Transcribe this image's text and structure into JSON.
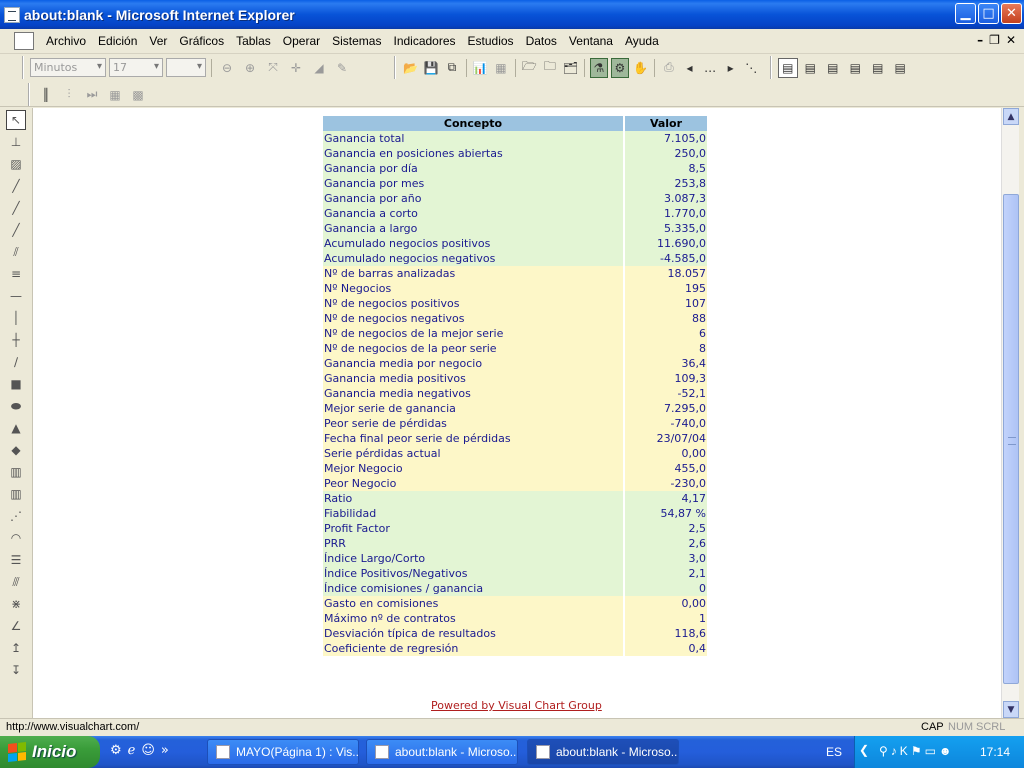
{
  "window": {
    "title": "about:blank - Microsoft Internet Explorer"
  },
  "menu": [
    "Archivo",
    "Edición",
    "Ver",
    "Gráficos",
    "Tablas",
    "Operar",
    "Sistemas",
    "Indicadores",
    "Estudios",
    "Datos",
    "Ventana",
    "Ayuda"
  ],
  "toolbar": {
    "timeframe": "Minutos",
    "period": "17",
    "third": ""
  },
  "table": {
    "headers": [
      "Concepto",
      "Valor"
    ],
    "rows": [
      {
        "c": "Ganancia total",
        "v": "7.105,0",
        "color": "green"
      },
      {
        "c": "Ganancia en posiciones abiertas",
        "v": "250,0",
        "color": "green"
      },
      {
        "c": "Ganancia por día",
        "v": "8,5",
        "color": "green"
      },
      {
        "c": "Ganancia por mes",
        "v": "253,8",
        "color": "green"
      },
      {
        "c": "Ganancia por año",
        "v": "3.087,3",
        "color": "green"
      },
      {
        "c": "Ganancia a corto",
        "v": "1.770,0",
        "color": "green"
      },
      {
        "c": "Ganancia a largo",
        "v": "5.335,0",
        "color": "green"
      },
      {
        "c": "Acumulado negocios positivos",
        "v": "11.690,0",
        "color": "green"
      },
      {
        "c": "Acumulado negocios negativos",
        "v": "-4.585,0",
        "color": "green"
      },
      {
        "c": "Nº de barras analizadas",
        "v": "18.057",
        "color": "yellow"
      },
      {
        "c": "Nº Negocios",
        "v": "195",
        "color": "yellow"
      },
      {
        "c": "Nº de negocios positivos",
        "v": "107",
        "color": "yellow"
      },
      {
        "c": "Nº de negocios negativos",
        "v": "88",
        "color": "yellow"
      },
      {
        "c": "Nº de negocios de la mejor serie",
        "v": "6",
        "color": "yellow"
      },
      {
        "c": "Nº de negocios de la peor serie",
        "v": "8",
        "color": "yellow"
      },
      {
        "c": "Ganancia media por negocio",
        "v": "36,4",
        "color": "yellow"
      },
      {
        "c": "Ganancia media positivos",
        "v": "109,3",
        "color": "yellow"
      },
      {
        "c": "Ganancia media negativos",
        "v": "-52,1",
        "color": "yellow"
      },
      {
        "c": "Mejor serie de ganancia",
        "v": "7.295,0",
        "color": "yellow"
      },
      {
        "c": "Peor serie de pérdidas",
        "v": "-740,0",
        "color": "yellow"
      },
      {
        "c": "Fecha final peor serie de pérdidas",
        "v": "23/07/04",
        "color": "yellow"
      },
      {
        "c": "Serie pérdidas actual",
        "v": "0,00",
        "color": "yellow"
      },
      {
        "c": "Mejor Negocio",
        "v": "455,0",
        "color": "yellow"
      },
      {
        "c": "Peor Negocio",
        "v": "-230,0",
        "color": "yellow"
      },
      {
        "c": "Ratio",
        "v": "4,17",
        "color": "green"
      },
      {
        "c": "Fiabilidad",
        "v": "54,87 %",
        "color": "green"
      },
      {
        "c": "Profit Factor",
        "v": "2,5",
        "color": "green"
      },
      {
        "c": "PRR",
        "v": "2,6",
        "color": "green"
      },
      {
        "c": "Índice Largo/Corto",
        "v": "3,0",
        "color": "green"
      },
      {
        "c": "Índice Positivos/Negativos",
        "v": "2,1",
        "color": "green"
      },
      {
        "c": "Índice comisiones / ganancia",
        "v": "0",
        "color": "green"
      },
      {
        "c": "Gasto en comisiones",
        "v": "0,00",
        "color": "yellow"
      },
      {
        "c": "Máximo nº de contratos",
        "v": "1",
        "color": "yellow"
      },
      {
        "c": "Desviación típica de resultados",
        "v": "118,6",
        "color": "yellow"
      },
      {
        "c": "Coeficiente de regresión",
        "v": "0,4",
        "color": "yellow"
      }
    ]
  },
  "footer_link": "Powered by Visual Chart Group",
  "status": {
    "url": "http://www.visualchart.com/",
    "cap": "CAP",
    "num": "NUM",
    "scrl": "SCRL"
  },
  "taskbar": {
    "start": "Inicio",
    "tasks": [
      "MAYO(Página 1) : Vis...",
      "about:blank - Microso...",
      "about:blank - Microso..."
    ],
    "lang": "ES",
    "clock": "17:14"
  },
  "colors": {
    "green_row": "#e3f5d4",
    "yellow_row": "#fdf7c8",
    "header": "#9cc3e0",
    "link": "#b01e1e"
  }
}
